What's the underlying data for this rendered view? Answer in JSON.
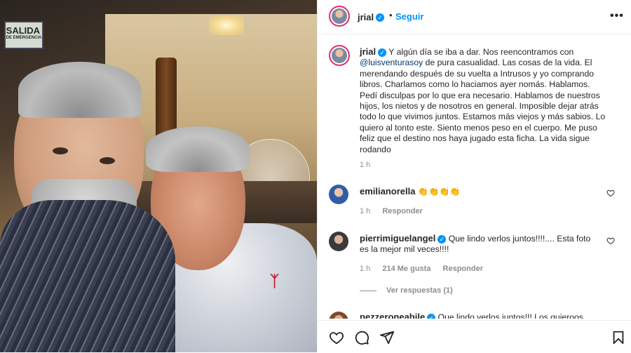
{
  "photo": {
    "exit_sign": "SALIDA",
    "exit_sign_sub": "DE EMERGENCIA"
  },
  "header": {
    "username": "jrial",
    "separator": "•",
    "follow_label": "Seguir",
    "more_label": "•••"
  },
  "caption": {
    "username": "jrial",
    "text_part1": "Y algún día se iba a dar. Nos reencontramos con",
    "mention": "@luisventurasoy",
    "text_part2": "de pura casualidad. Las cosas de la vida. El merendando después de su vuelta a Intrusos y yo comprando libros. Charlamos como lo haciamos ayer nomás. Hablamos. Pedí disculpas por lo que era necesario. Hablamos de nuestros hijos, los nietos y de nosotros en general. Imposible dejar atrás todo lo que vivimos juntos. Estamos más viejos y más sabios. Lo quiero al tonto este. Siento menos peso en el cuerpo. Me puso feliz que el destino nos haya jugado esta ficha. La vida sigue rodando",
    "time": "1 h"
  },
  "comments": [
    {
      "username": "emilianorella",
      "text": "👏👏👏👏",
      "time": "1 h",
      "reply_label": "Responder"
    },
    {
      "username": "pierrimiguelangel",
      "text": "Que lindo verlos juntos!!!!.... Esta foto es la mejor mil veces!!!!",
      "time": "1 h",
      "likes": "214 Me gusta",
      "reply_label": "Responder",
      "view_replies": "Ver respuestas (1)"
    },
    {
      "username": "pezzeroneabile",
      "text": "Que lindo verlos juntos!!! Los quieroos"
    }
  ],
  "actions": {
    "like_icon": "heart-icon",
    "comment_icon": "comment-icon",
    "share_icon": "share-icon",
    "save_icon": "bookmark-icon"
  },
  "colors": {
    "link_blue": "#0095f6",
    "mention_blue": "#00376b",
    "muted_gray": "#8e8e8e",
    "text": "#262626"
  }
}
